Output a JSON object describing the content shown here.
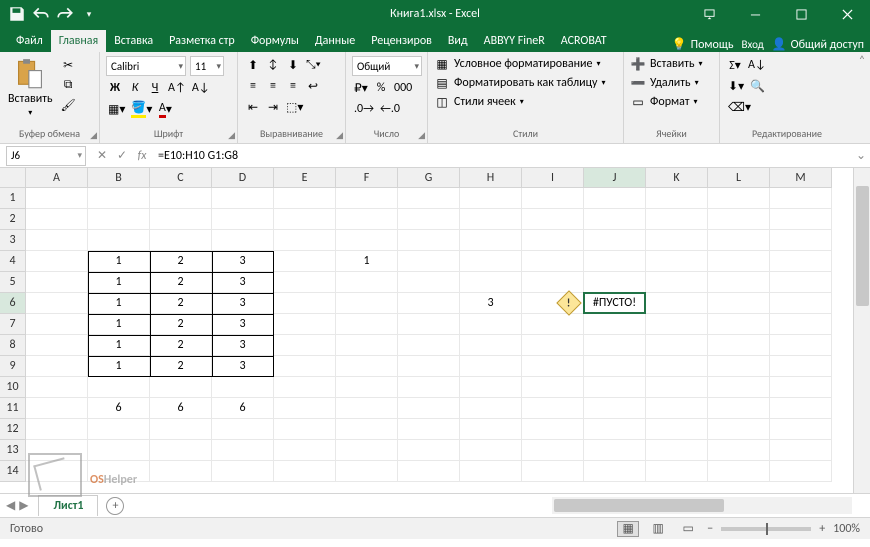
{
  "title": "Книга1.xlsx - Excel",
  "qat": {
    "save": "save",
    "undo": "undo",
    "redo": "redo"
  },
  "win": {
    "opts": "ribbon-display-options",
    "min": "minimize",
    "max": "maximize",
    "close": "close"
  },
  "tabs": {
    "file": "Файл",
    "home": "Главная",
    "insert": "Вставка",
    "layout": "Разметка стр",
    "formulas": "Формулы",
    "data": "Данные",
    "review": "Рецензиров",
    "view": "Вид",
    "abbyy": "ABBYY FineR",
    "acrobat": "ACROBAT",
    "help": "Помощь",
    "login": "Вход",
    "share": "Общий доступ"
  },
  "ribbon": {
    "clipboard": {
      "label": "Буфер обмена",
      "paste": "Вставить"
    },
    "font": {
      "label": "Шрифт",
      "name": "Calibri",
      "size": "11",
      "bold": "Ж",
      "italic": "К",
      "underline": "Ч"
    },
    "align": {
      "label": "Выравнивание"
    },
    "number": {
      "label": "Число",
      "format": "Общий"
    },
    "styles": {
      "label": "Стили",
      "cond": "Условное форматирование",
      "table": "Форматировать как таблицу",
      "cell": "Стили ячеек"
    },
    "cells": {
      "label": "Ячейки",
      "insert": "Вставить",
      "delete": "Удалить",
      "format": "Формат"
    },
    "edit": {
      "label": "Редактирование"
    }
  },
  "formula_bar": {
    "name": "J6",
    "fx": "fx",
    "formula": "=E10:H10 G1:G8"
  },
  "columns": [
    "A",
    "B",
    "C",
    "D",
    "E",
    "F",
    "G",
    "H",
    "I",
    "J",
    "K",
    "L",
    "M"
  ],
  "rows": [
    "1",
    "2",
    "3",
    "4",
    "5",
    "6",
    "7",
    "8",
    "9",
    "10",
    "11",
    "12",
    "13",
    "14"
  ],
  "cells": {
    "B4": "1",
    "C4": "2",
    "D4": "3",
    "F4": "1",
    "B5": "1",
    "C5": "2",
    "D5": "3",
    "B6": "1",
    "C6": "2",
    "D6": "3",
    "H6": "3",
    "J6": "#ПУСТО!",
    "B7": "1",
    "C7": "2",
    "D7": "3",
    "B8": "1",
    "C8": "2",
    "D8": "3",
    "B9": "1",
    "C9": "2",
    "D9": "3",
    "B11": "6",
    "C11": "6",
    "D11": "6"
  },
  "active": {
    "col": "J",
    "row": "6",
    "colIndex": 9,
    "rowIndex": 5
  },
  "sheet_tab": "Лист1",
  "status": {
    "ready": "Готово",
    "zoom": "100%"
  },
  "watermark": {
    "os": "OS",
    "helper": "Helper"
  }
}
